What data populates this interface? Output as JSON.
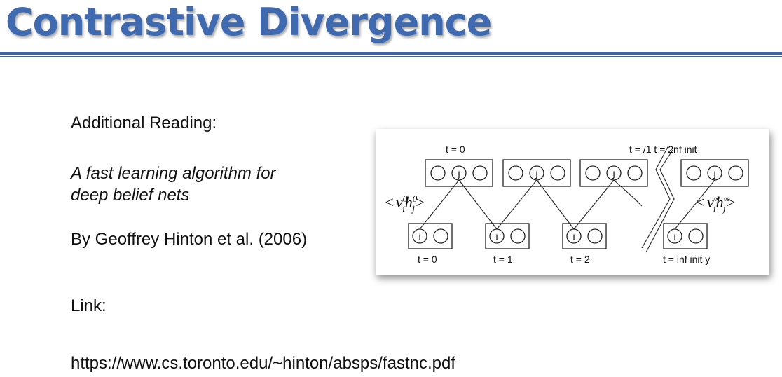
{
  "title": "Contrastive Divergence",
  "reading_label": "Additional Reading:",
  "paper_title_line1": "A fast learning algorithm for",
  "paper_title_line2": "deep belief nets",
  "byline": "By Geoffrey Hinton et al. (2006)",
  "link_label": "Link:",
  "link_url": "https://www.cs.toronto.edu/~hinton/absps/fastnc.pdf",
  "figure": {
    "top_left_label": "t   =   0",
    "top_right_label": "t   = /1   t   =  2nf init",
    "bottom_labels": [
      "t = 0",
      "t = 1",
      "t = 2",
      "t   =   inf init y"
    ],
    "hidden_unit": "j",
    "visible_unit": "i",
    "corr_left_open": "<",
    "corr_left_v": "v",
    "corr_left_i": "i",
    "corr_left_sup1": "0",
    "corr_left_h": "h",
    "corr_left_j": "j",
    "corr_left_sup2": "0",
    "corr_left_close": ">",
    "corr_right_open": "<",
    "corr_right_v": "v",
    "corr_right_i": "i",
    "corr_right_sup1": "∞",
    "corr_right_h": "h",
    "corr_right_j": "j",
    "corr_right_sup2": "∞",
    "corr_right_close": ">"
  }
}
